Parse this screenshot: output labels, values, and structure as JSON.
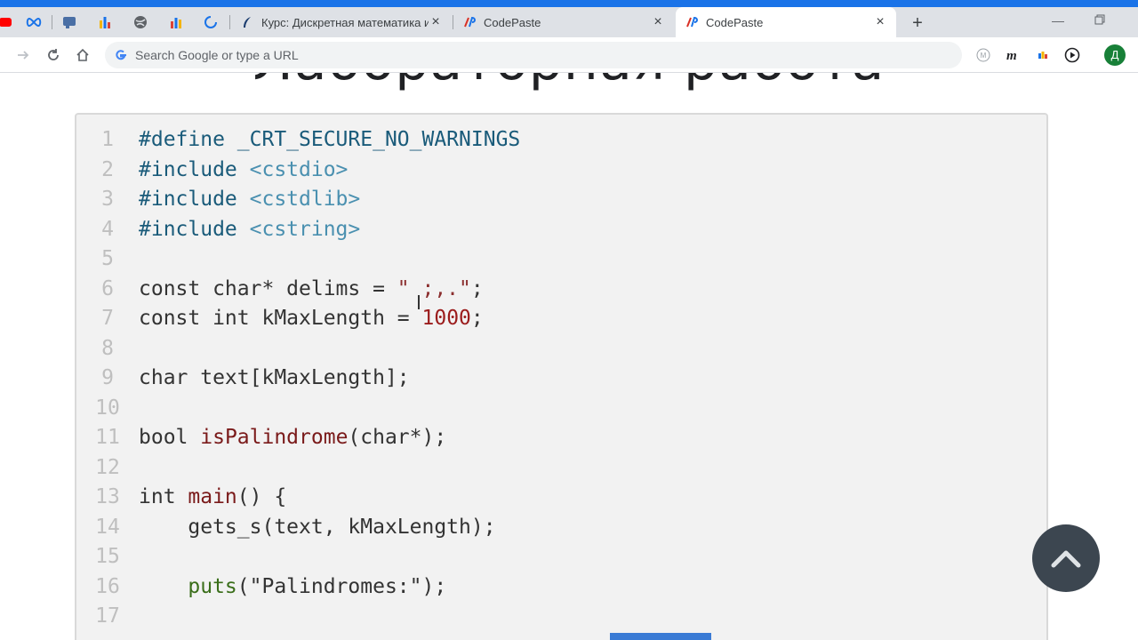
{
  "browser": {
    "pinned_tabs": [
      {
        "icon": "youtube-icon"
      },
      {
        "icon": "infinity-icon"
      },
      {
        "icon": "chat-icon"
      },
      {
        "icon": "chart-icon"
      },
      {
        "icon": "globe-icon"
      },
      {
        "icon": "bar-chart-icon"
      },
      {
        "icon": "loading-icon"
      }
    ],
    "tabs": [
      {
        "title": "Курс: Дискретная математика и",
        "icon": "feather-icon",
        "active": false
      },
      {
        "title": "CodePaste",
        "icon": "codepaste-icon",
        "active": false
      },
      {
        "title": "CodePaste",
        "icon": "codepaste-icon",
        "active": true
      }
    ],
    "new_tab_label": "+",
    "omnibox_placeholder": "Search Google or type a URL",
    "profile_initial": "Д",
    "extensions": [
      "m-circle-icon",
      "m-italic-icon",
      "colorful-dots-icon",
      "play-circle-icon"
    ]
  },
  "page": {
    "title": "Лабораторная работа"
  },
  "code": {
    "lines": [
      {
        "n": "1"
      },
      {
        "n": "2"
      },
      {
        "n": "3"
      },
      {
        "n": "4"
      },
      {
        "n": "5"
      },
      {
        "n": "6"
      },
      {
        "n": "7"
      },
      {
        "n": "8"
      },
      {
        "n": "9"
      },
      {
        "n": "10"
      },
      {
        "n": "11"
      },
      {
        "n": "12"
      },
      {
        "n": "13"
      },
      {
        "n": "14"
      },
      {
        "n": "15"
      },
      {
        "n": "16"
      },
      {
        "n": "17"
      }
    ],
    "t": {
      "l1_pp": "#define",
      "l1_rest": " _CRT_SECURE_NO_WARNINGS",
      "l2_pp": "#include",
      "l2_hdr": " <cstdio>",
      "l3_pp": "#include",
      "l3_hdr": " <cstdlib>",
      "l4_pp": "#include",
      "l4_hdr": " <cstring>",
      "l6_a": "const char* delims = ",
      "l6_str": "\" ;,.\"",
      "l6_b": ";",
      "l7_a": "const int kMaxLength = ",
      "l7_num": "1000",
      "l7_b": ";",
      "l9": "char text[kMaxLength];",
      "l11_a": "bool ",
      "l11_fn": "isPalindrome",
      "l11_b": "(char*);",
      "l13_a": "int ",
      "l13_fn": "main",
      "l13_b": "() {",
      "l14": "    gets_s(text, kMaxLength);",
      "l16_indent": "    ",
      "l16_call": "puts",
      "l16_b": "(\"Palindromes:\");"
    }
  },
  "colors": {
    "accent": "#1a73e8",
    "scroll_button": "#3c4650"
  }
}
